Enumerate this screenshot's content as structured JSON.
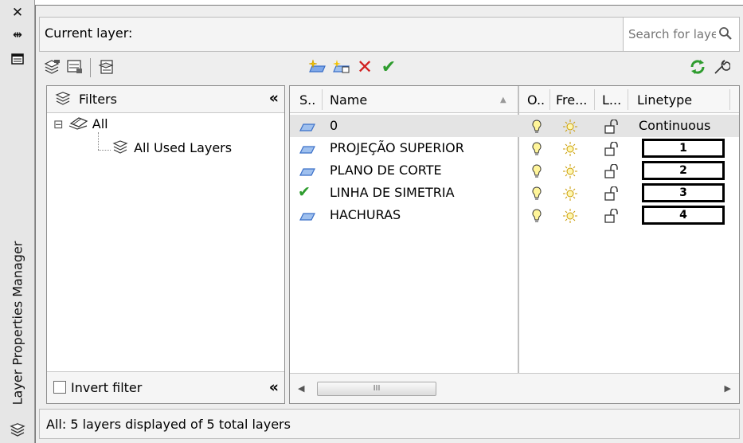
{
  "palette": {
    "title": "Layer Properties Manager"
  },
  "header": {
    "current_layer_label": "Current layer:",
    "search_placeholder": "Search for layer"
  },
  "filters": {
    "heading": "Filters",
    "tree": [
      {
        "label": "All",
        "expand_glyph": "⊟"
      },
      {
        "label": "All Used Layers"
      }
    ],
    "invert_label": "Invert filter",
    "invert_checked": false,
    "collapse_glyph": "«"
  },
  "columns": {
    "status": "S..",
    "name": "Name",
    "on": "O..",
    "freeze": "Fre...",
    "lock": "L...",
    "linetype": "Linetype"
  },
  "layers": [
    {
      "status": "layer-icon",
      "name": "0",
      "linetype": "Continuous",
      "selected": true
    },
    {
      "status": "layer-icon",
      "name": "PROJEÇÃO SUPERIOR",
      "linetype": "1"
    },
    {
      "status": "layer-icon",
      "name": "PLANO DE CORTE",
      "linetype": "2"
    },
    {
      "status": "current-check-icon",
      "name": "LINHA DE SIMETRIA",
      "linetype": "3"
    },
    {
      "status": "layer-icon",
      "name": "HACHURAS",
      "linetype": "4"
    }
  ],
  "scrollbar": {
    "thumb_glyph": "III"
  },
  "status_bar": {
    "text": "All: 5 layers displayed of 5 total layers"
  },
  "colors": {
    "accent_green": "#2e9c2e",
    "delete_red": "#d22020",
    "layer_blue": "#3a6fc8",
    "sun_yellow": "#f2c200"
  }
}
